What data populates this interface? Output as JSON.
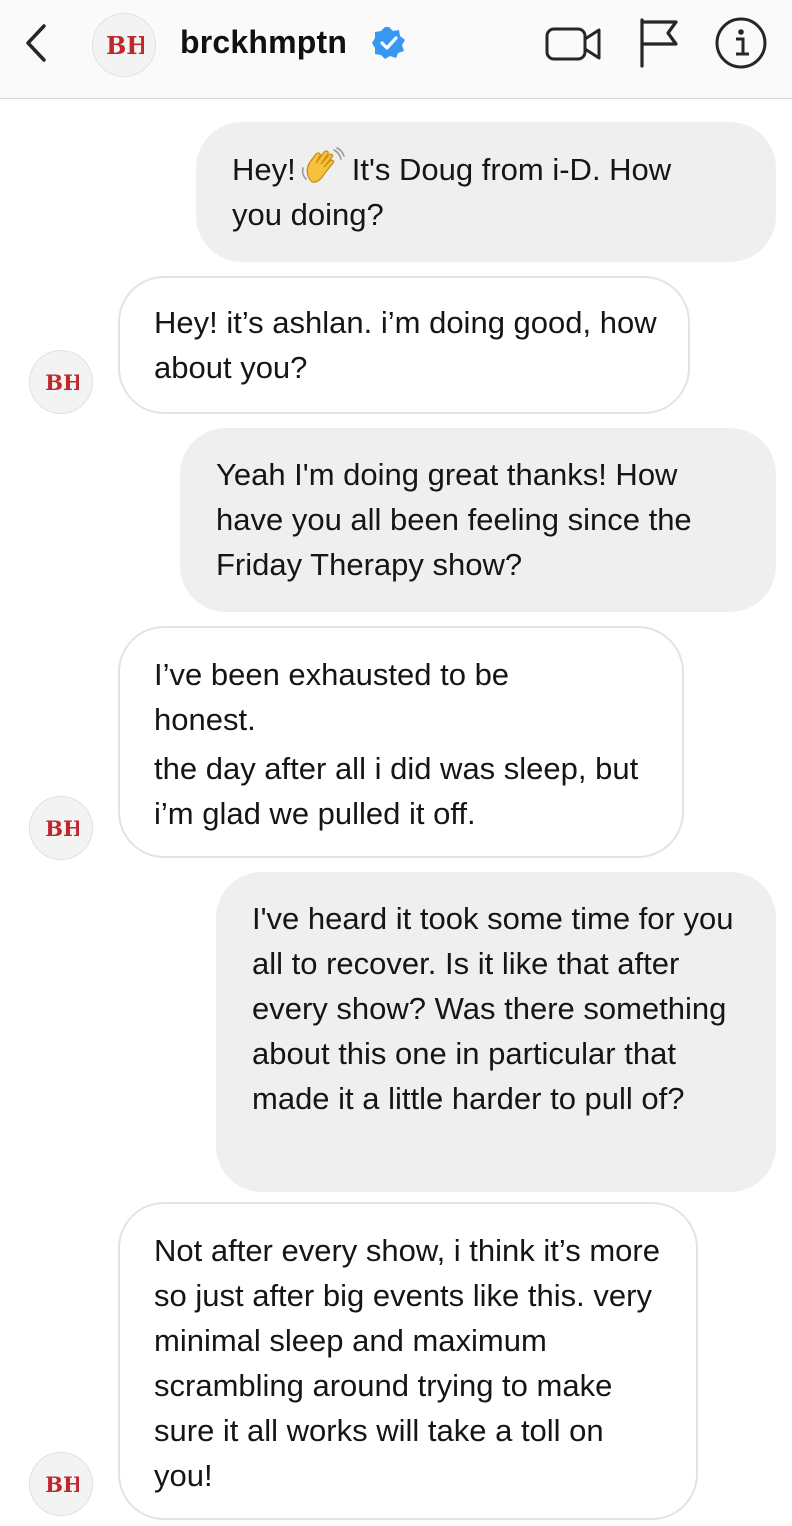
{
  "header": {
    "username": "brckhmptn",
    "verified": true,
    "icons": {
      "back": "back-chevron-icon",
      "avatar_logo": "bh-logo",
      "verified": "verified-badge-icon",
      "video": "video-call-icon",
      "flag": "flag-icon",
      "info": "info-icon"
    }
  },
  "colors": {
    "verified_blue": "#3897f0",
    "outgoing_bubble": "#efefef",
    "logo_red": "#c0272d"
  },
  "messages": [
    {
      "direction": "outgoing",
      "lines": [
        "Hey! {wave} It's Doug from i-D. How you doing?"
      ],
      "text_before_emoji": "Hey!",
      "text_after_emoji": "It's Doug from i-D. How",
      "text_line2": "you doing?",
      "emoji": "waving-hand"
    },
    {
      "direction": "incoming",
      "lines": [
        "Hey! it’s ashlan. i’m doing good, how about you?"
      ]
    },
    {
      "direction": "outgoing",
      "lines": [
        "Yeah I'm doing great thanks! How have you all been feeling since the Friday Therapy show?"
      ]
    },
    {
      "direction": "incoming",
      "lines": [
        "I’ve been exhausted to be honest.",
        "the day after all i did was sleep, but i’m glad we pulled it off."
      ]
    },
    {
      "direction": "outgoing",
      "lines": [
        "I've heard it took some time for you all to recover. Is it like that after every show? Was there something about this one in particular that made it a little harder to pull of?"
      ]
    },
    {
      "direction": "incoming",
      "lines": [
        "Not after every show, i think it’s more so just after big events like this. very minimal sleep and maximum scrambling around trying to make sure it all works will take a toll on you!"
      ]
    }
  ]
}
